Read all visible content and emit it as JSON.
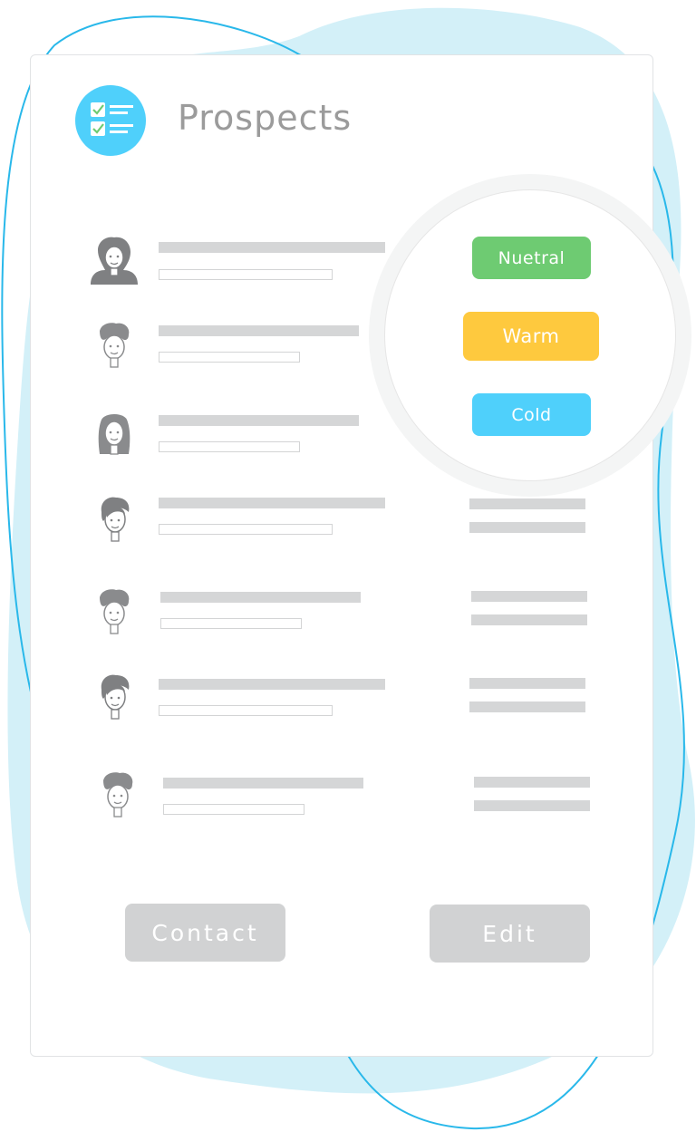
{
  "header": {
    "title": "Prospects",
    "icon": "checklist-icon",
    "icon_color": "#4fd0fb"
  },
  "prospects": [
    {
      "avatar": "woman-curly-hair-avatar-icon"
    },
    {
      "avatar": "man-avatar-icon"
    },
    {
      "avatar": "woman-long-hair-avatar-icon"
    },
    {
      "avatar": "woman-side-bangs-avatar-icon"
    },
    {
      "avatar": "man-avatar-icon"
    },
    {
      "avatar": "woman-side-bangs-avatar-icon"
    },
    {
      "avatar": "man-avatar-icon"
    }
  ],
  "temperature_options": [
    {
      "label": "Nuetral",
      "color": "#6ecb72"
    },
    {
      "label": "Warm",
      "color": "#fec93e"
    },
    {
      "label": "Cold",
      "color": "#4fd0fb"
    }
  ],
  "actions": {
    "contact_label": "Contact",
    "edit_label": "Edit"
  },
  "colors": {
    "background_blob": "#d3f0f8",
    "outline_curve": "#29b8ea",
    "placeholder_bar": "#d5d6d7",
    "button_gray": "#d1d2d3"
  }
}
